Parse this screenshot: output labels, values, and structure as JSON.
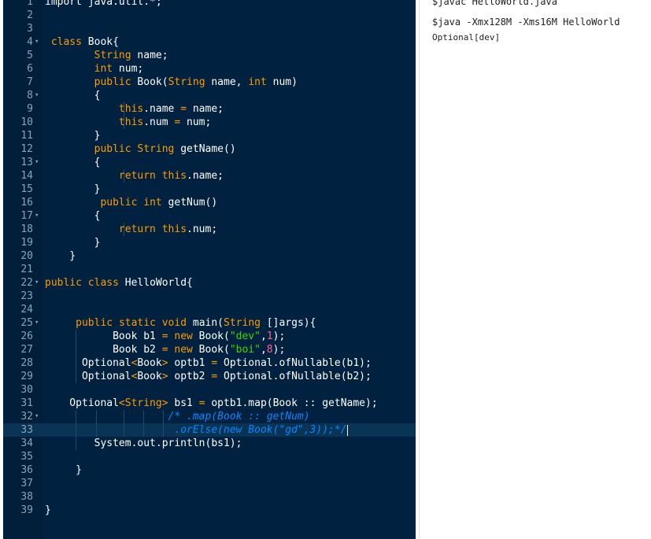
{
  "editor": {
    "lines": [
      {
        "n": "1",
        "fold": "",
        "code": [
          {
            "t": "import java.util.*;",
            "c": ""
          }
        ]
      },
      {
        "n": "2",
        "fold": "",
        "code": []
      },
      {
        "n": "3",
        "fold": "",
        "code": []
      },
      {
        "n": "4",
        "fold": "▾",
        "code": [
          {
            "t": " ",
            "c": ""
          },
          {
            "t": "class",
            "c": "kw"
          },
          {
            "t": " Book{",
            "c": ""
          }
        ]
      },
      {
        "n": "5",
        "fold": "",
        "code": [
          {
            "t": "        ",
            "c": ""
          },
          {
            "t": "String",
            "c": "kw"
          },
          {
            "t": " name;",
            "c": ""
          }
        ]
      },
      {
        "n": "6",
        "fold": "",
        "code": [
          {
            "t": "        ",
            "c": ""
          },
          {
            "t": "int",
            "c": "kw"
          },
          {
            "t": " num;",
            "c": ""
          }
        ]
      },
      {
        "n": "7",
        "fold": "",
        "code": [
          {
            "t": "        ",
            "c": ""
          },
          {
            "t": "public",
            "c": "kw"
          },
          {
            "t": " Book(",
            "c": ""
          },
          {
            "t": "String",
            "c": "kw"
          },
          {
            "t": " name, ",
            "c": ""
          },
          {
            "t": "int",
            "c": "kw"
          },
          {
            "t": " num)",
            "c": ""
          }
        ]
      },
      {
        "n": "8",
        "fold": "▾",
        "code": [
          {
            "t": "        {",
            "c": ""
          }
        ]
      },
      {
        "n": "9",
        "fold": "",
        "code": [
          {
            "t": "            ",
            "c": ""
          },
          {
            "t": "this",
            "c": "kw"
          },
          {
            "t": ".name ",
            "c": ""
          },
          {
            "t": "=",
            "c": "kw"
          },
          {
            "t": " name;",
            "c": ""
          }
        ]
      },
      {
        "n": "10",
        "fold": "",
        "code": [
          {
            "t": "            ",
            "c": ""
          },
          {
            "t": "this",
            "c": "kw"
          },
          {
            "t": ".num ",
            "c": ""
          },
          {
            "t": "=",
            "c": "kw"
          },
          {
            "t": " num;",
            "c": ""
          }
        ]
      },
      {
        "n": "11",
        "fold": "",
        "code": [
          {
            "t": "        }",
            "c": ""
          }
        ]
      },
      {
        "n": "12",
        "fold": "",
        "code": [
          {
            "t": "        ",
            "c": ""
          },
          {
            "t": "public",
            "c": "kw"
          },
          {
            "t": " ",
            "c": ""
          },
          {
            "t": "String",
            "c": "kw"
          },
          {
            "t": " getName()",
            "c": ""
          }
        ]
      },
      {
        "n": "13",
        "fold": "▾",
        "code": [
          {
            "t": "        {",
            "c": ""
          }
        ]
      },
      {
        "n": "14",
        "fold": "",
        "code": [
          {
            "t": "            ",
            "c": ""
          },
          {
            "t": "return",
            "c": "kw"
          },
          {
            "t": " ",
            "c": ""
          },
          {
            "t": "this",
            "c": "kw"
          },
          {
            "t": ".name;",
            "c": ""
          }
        ]
      },
      {
        "n": "15",
        "fold": "",
        "code": [
          {
            "t": "        }",
            "c": ""
          }
        ]
      },
      {
        "n": "16",
        "fold": "",
        "code": [
          {
            "t": "         ",
            "c": ""
          },
          {
            "t": "public",
            "c": "kw"
          },
          {
            "t": " ",
            "c": ""
          },
          {
            "t": "int",
            "c": "kw"
          },
          {
            "t": " getNum()",
            "c": ""
          }
        ]
      },
      {
        "n": "17",
        "fold": "▾",
        "code": [
          {
            "t": "        {",
            "c": ""
          }
        ]
      },
      {
        "n": "18",
        "fold": "",
        "code": [
          {
            "t": "            ",
            "c": ""
          },
          {
            "t": "return",
            "c": "kw"
          },
          {
            "t": " ",
            "c": ""
          },
          {
            "t": "this",
            "c": "kw"
          },
          {
            "t": ".num;",
            "c": ""
          }
        ]
      },
      {
        "n": "19",
        "fold": "",
        "code": [
          {
            "t": "        }",
            "c": ""
          }
        ]
      },
      {
        "n": "20",
        "fold": "",
        "code": [
          {
            "t": "    }",
            "c": ""
          }
        ]
      },
      {
        "n": "21",
        "fold": "",
        "code": []
      },
      {
        "n": "22",
        "fold": "▾",
        "code": [
          {
            "t": "public",
            "c": "kw"
          },
          {
            "t": " ",
            "c": ""
          },
          {
            "t": "class",
            "c": "kw"
          },
          {
            "t": " HelloWorld{",
            "c": ""
          }
        ]
      },
      {
        "n": "23",
        "fold": "",
        "code": []
      },
      {
        "n": "24",
        "fold": "",
        "code": []
      },
      {
        "n": "25",
        "fold": "▾",
        "code": [
          {
            "t": "     ",
            "c": ""
          },
          {
            "t": "public",
            "c": "kw"
          },
          {
            "t": " ",
            "c": ""
          },
          {
            "t": "static",
            "c": "kw"
          },
          {
            "t": " ",
            "c": ""
          },
          {
            "t": "void",
            "c": "kw"
          },
          {
            "t": " main(",
            "c": ""
          },
          {
            "t": "String",
            "c": "kw"
          },
          {
            "t": " []args){",
            "c": ""
          }
        ]
      },
      {
        "n": "26",
        "fold": "",
        "code": [
          {
            "t": "           Book b1 ",
            "c": ""
          },
          {
            "t": "=",
            "c": "kw"
          },
          {
            "t": " ",
            "c": ""
          },
          {
            "t": "new",
            "c": "kw"
          },
          {
            "t": " Book(",
            "c": ""
          },
          {
            "t": "\"dev\"",
            "c": "str"
          },
          {
            "t": ",",
            "c": ""
          },
          {
            "t": "1",
            "c": "num"
          },
          {
            "t": ");",
            "c": ""
          }
        ]
      },
      {
        "n": "27",
        "fold": "",
        "code": [
          {
            "t": "           Book b2 ",
            "c": ""
          },
          {
            "t": "=",
            "c": "kw"
          },
          {
            "t": " ",
            "c": ""
          },
          {
            "t": "new",
            "c": "kw"
          },
          {
            "t": " Book(",
            "c": ""
          },
          {
            "t": "\"boi\"",
            "c": "str"
          },
          {
            "t": ",",
            "c": ""
          },
          {
            "t": "8",
            "c": "num"
          },
          {
            "t": ");",
            "c": ""
          }
        ]
      },
      {
        "n": "28",
        "fold": "",
        "code": [
          {
            "t": "      Optional",
            "c": ""
          },
          {
            "t": "<",
            "c": "kw"
          },
          {
            "t": "Book",
            "c": ""
          },
          {
            "t": ">",
            "c": "kw"
          },
          {
            "t": " optb1 ",
            "c": ""
          },
          {
            "t": "=",
            "c": "kw"
          },
          {
            "t": " Optional.ofNullable(b1);",
            "c": ""
          }
        ]
      },
      {
        "n": "29",
        "fold": "",
        "code": [
          {
            "t": "      Optional",
            "c": ""
          },
          {
            "t": "<",
            "c": "kw"
          },
          {
            "t": "Book",
            "c": ""
          },
          {
            "t": ">",
            "c": "kw"
          },
          {
            "t": " optb2 ",
            "c": ""
          },
          {
            "t": "=",
            "c": "kw"
          },
          {
            "t": " Optional.ofNullable(b2);",
            "c": ""
          }
        ]
      },
      {
        "n": "30",
        "fold": "",
        "code": []
      },
      {
        "n": "31",
        "fold": "",
        "code": [
          {
            "t": "    Optional",
            "c": ""
          },
          {
            "t": "<String>",
            "c": "kw"
          },
          {
            "t": " bs1 ",
            "c": ""
          },
          {
            "t": "=",
            "c": "kw"
          },
          {
            "t": " optb1.map(Book :: getName);",
            "c": ""
          }
        ]
      },
      {
        "n": "32",
        "fold": "▾",
        "code": [
          {
            "t": "                    ",
            "c": ""
          },
          {
            "t": "/* .map(Book :: getNum)",
            "c": "cm"
          }
        ]
      },
      {
        "n": "33",
        "fold": "",
        "code": [
          {
            "t": "                     ",
            "c": ""
          },
          {
            "t": ".orElse(new Book(\"gd\",3));*/",
            "c": "cm"
          }
        ]
      },
      {
        "n": "34",
        "fold": "",
        "code": [
          {
            "t": "        System.out.println(bs1);",
            "c": ""
          }
        ]
      },
      {
        "n": "35",
        "fold": "",
        "code": []
      },
      {
        "n": "36",
        "fold": "",
        "code": [
          {
            "t": "     }",
            "c": ""
          }
        ]
      },
      {
        "n": "37",
        "fold": "",
        "code": []
      },
      {
        "n": "38",
        "fold": "",
        "code": []
      },
      {
        "n": "39",
        "fold": "",
        "code": [
          {
            "t": "}",
            "c": ""
          }
        ]
      }
    ],
    "active_line": "33"
  },
  "output": {
    "lines": [
      "$javac HelloWorld.java",
      "$java -Xmx128M -Xms16M HelloWorld",
      "Optional[dev]"
    ]
  }
}
